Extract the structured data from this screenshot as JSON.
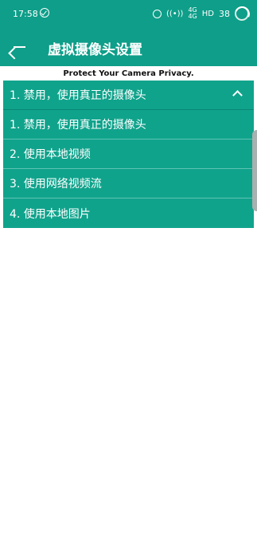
{
  "status_bar": {
    "time": "17:58",
    "network_top": "4G",
    "network_bottom": "4G",
    "hd": "HD",
    "battery_level": "38"
  },
  "app_bar": {
    "title": "虚拟摄像头设置"
  },
  "banner": {
    "text": "Protect Your Camera Privacy."
  },
  "select": {
    "current_value": "1. 禁用，使用真正的摄像头",
    "options": [
      "1. 禁用，使用真正的摄像头",
      "2. 使用本地视频",
      "3. 使用网络视频流",
      "4. 使用本地图片"
    ]
  },
  "colors": {
    "primary": "#0e9e89",
    "dropdown": "#10a38c"
  }
}
